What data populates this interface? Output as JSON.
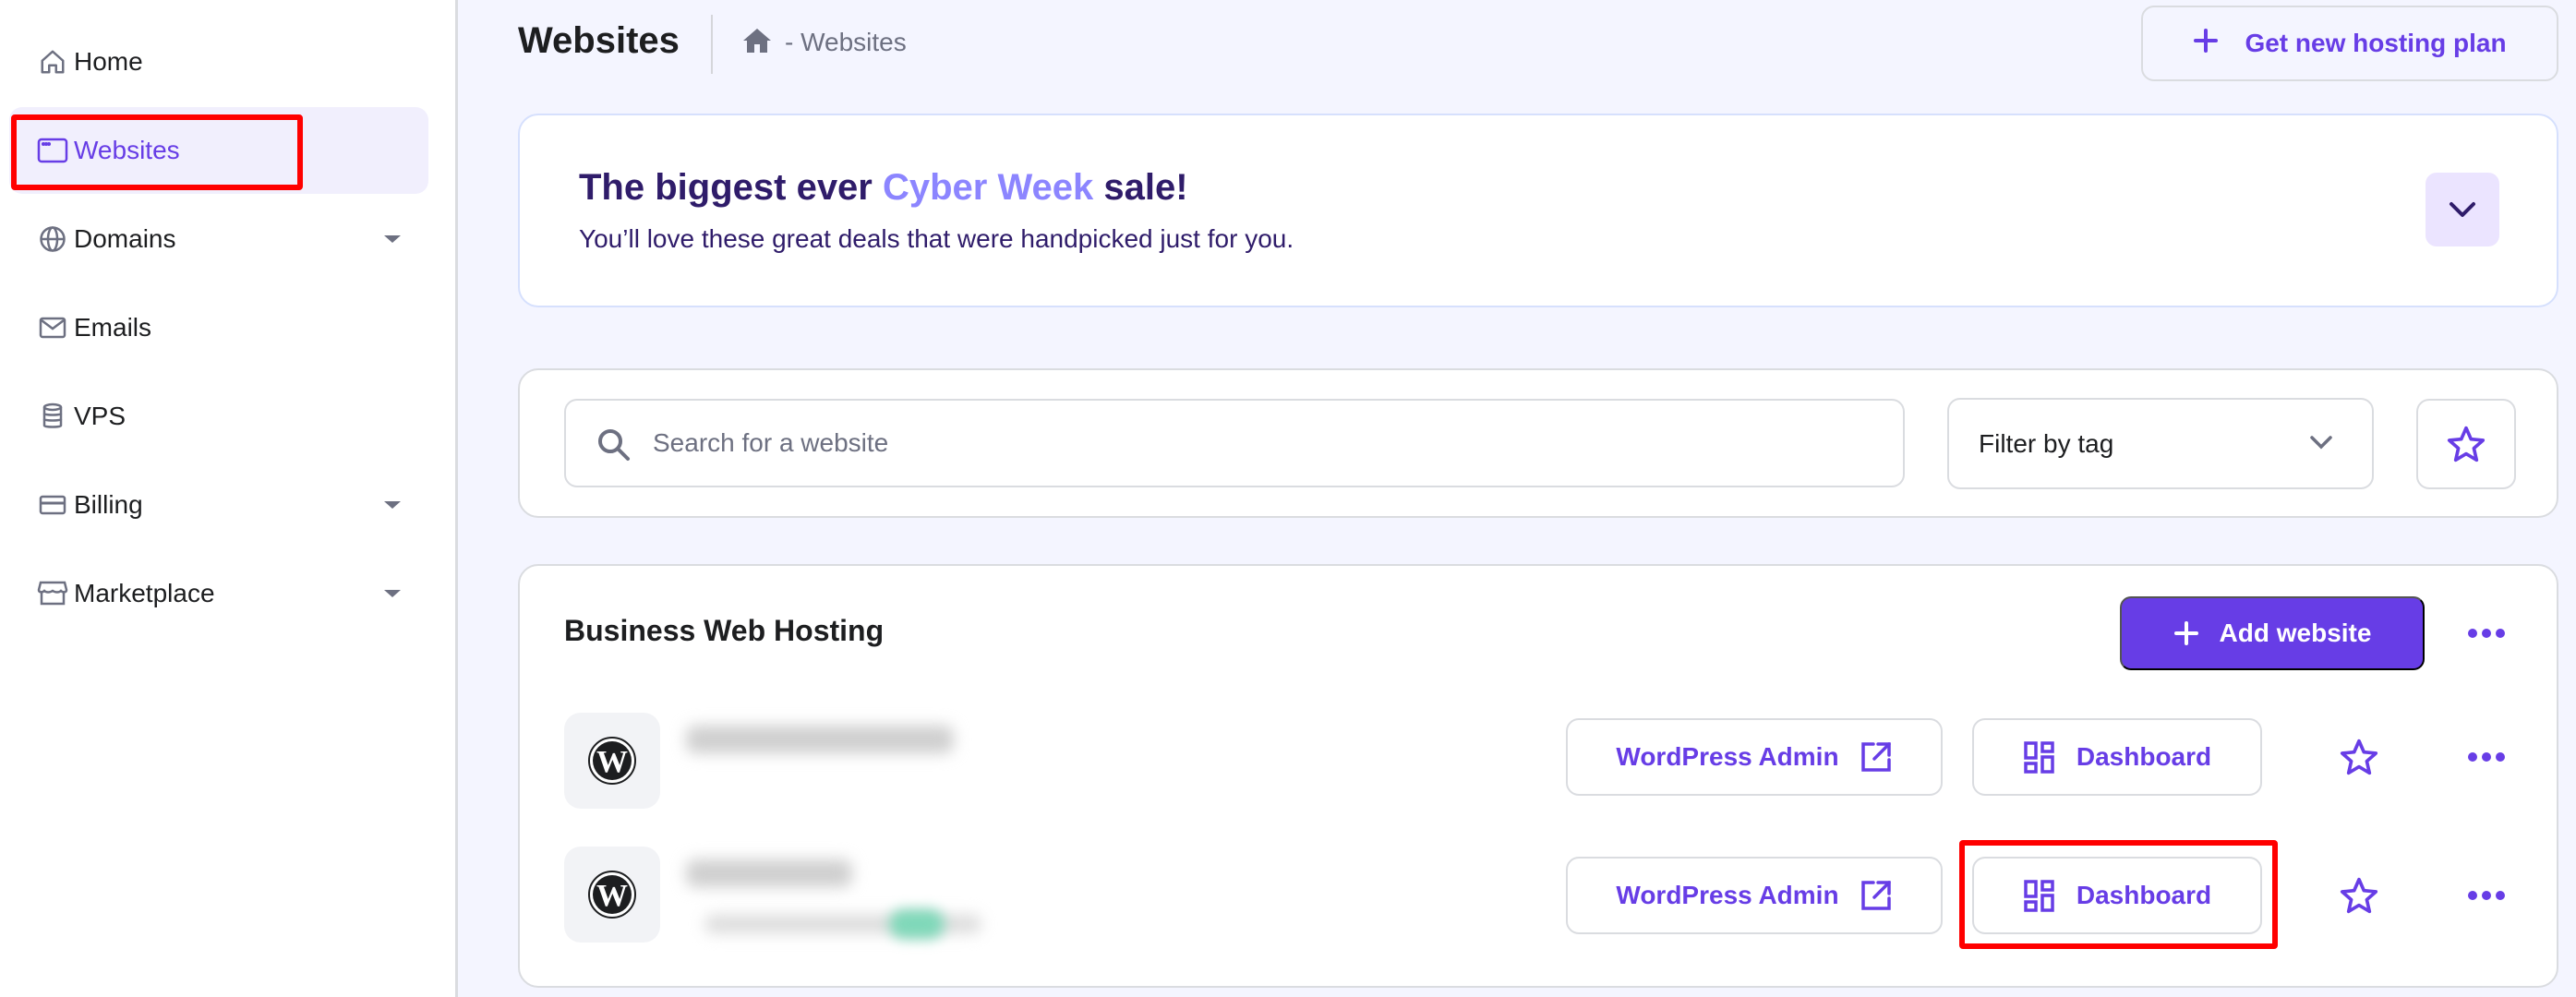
{
  "sidebar": {
    "items": [
      {
        "label": "Home",
        "icon": "home-icon",
        "has_caret": false,
        "active": false
      },
      {
        "label": "Websites",
        "icon": "browser-window-icon",
        "has_caret": false,
        "active": true
      },
      {
        "label": "Domains",
        "icon": "globe-icon",
        "has_caret": true,
        "active": false
      },
      {
        "label": "Emails",
        "icon": "envelope-icon",
        "has_caret": false,
        "active": false
      },
      {
        "label": "VPS",
        "icon": "database-icon",
        "has_caret": false,
        "active": false
      },
      {
        "label": "Billing",
        "icon": "credit-card-icon",
        "has_caret": true,
        "active": false
      },
      {
        "label": "Marketplace",
        "icon": "store-icon",
        "has_caret": true,
        "active": false
      }
    ]
  },
  "header": {
    "title": "Websites",
    "breadcrumb": "- Websites",
    "new_plan_label": "Get new hosting plan"
  },
  "promo": {
    "title_prefix": "The biggest ever ",
    "title_accent": "Cyber Week",
    "title_suffix": " sale!",
    "subtitle": "You’ll love these great deals that were handpicked just for you."
  },
  "search": {
    "placeholder": "Search for a website",
    "value": "",
    "filter_label": "Filter by tag"
  },
  "hosting": {
    "title": "Business Web Hosting",
    "add_label": "Add website",
    "sites": [
      {
        "name": "[blurred]",
        "wp_admin_label": "WordPress Admin",
        "dashboard_label": "Dashboard"
      },
      {
        "name": "[blurred]",
        "wp_admin_label": "WordPress Admin",
        "dashboard_label": "Dashboard"
      }
    ]
  },
  "colors": {
    "accent": "#673de6",
    "promo_title": "#2f1c6a",
    "promo_accent": "#8c85ff",
    "highlight": "#ff0000",
    "page_bg": "#f4f5ff"
  }
}
